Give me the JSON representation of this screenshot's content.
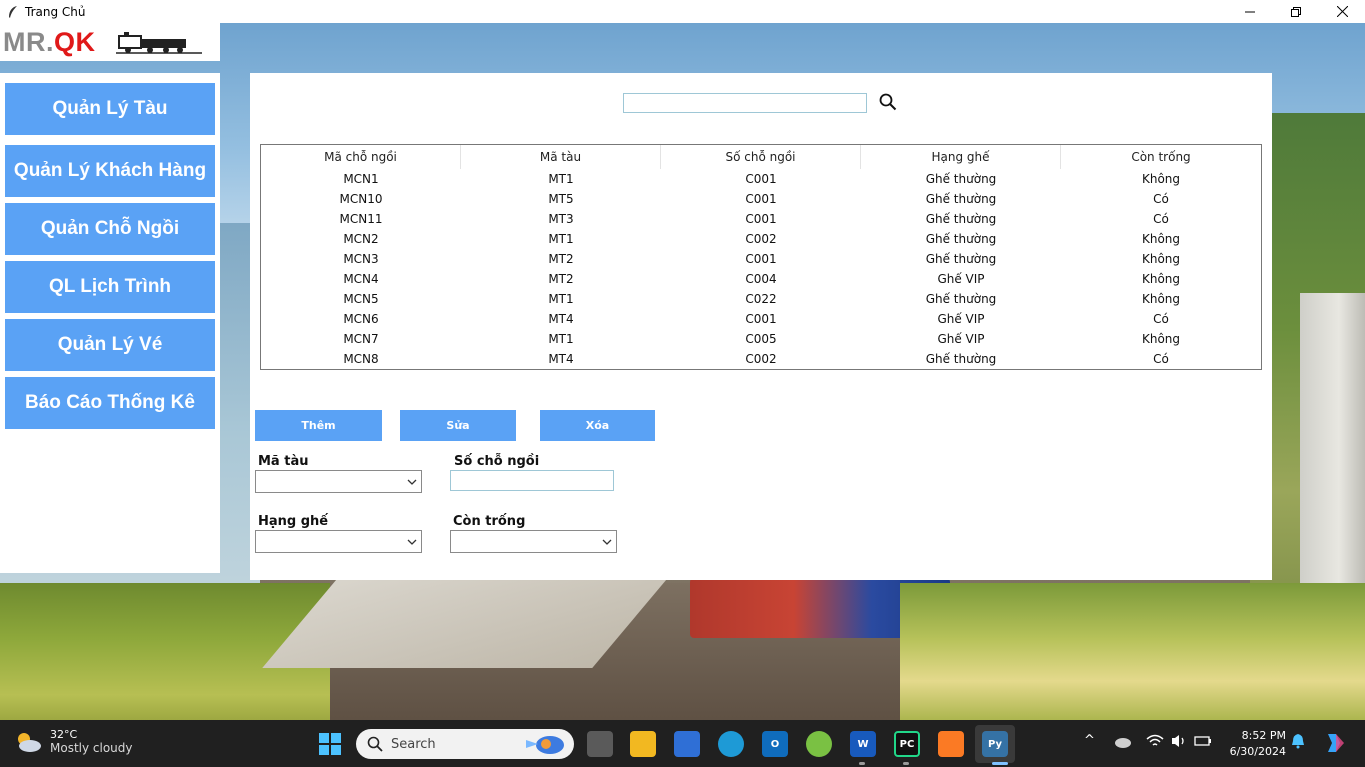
{
  "window": {
    "title": "Trang Chủ",
    "minimize_icon": "minimize-icon",
    "maximize_icon": "maximize-icon",
    "close_icon": "close-icon"
  },
  "logo": {
    "part1": "MR.",
    "part2": "QK",
    "colors": {
      "mr": "#8a8a8a",
      "qk": "#e01919"
    },
    "train_icon": "train-logo-icon"
  },
  "sidebar": {
    "items": [
      {
        "label": "Quản Lý Tàu"
      },
      {
        "label": "Quản Lý Khách Hàng"
      },
      {
        "label": "Quản Chỗ Ngồi"
      },
      {
        "label": "QL Lịch Trình"
      },
      {
        "label": "Quản Lý Vé"
      },
      {
        "label": "Báo Cáo Thống Kê"
      }
    ],
    "accent": "#5aa2f5"
  },
  "search": {
    "value": "",
    "icon": "search-icon"
  },
  "table": {
    "headers": [
      "Mã chỗ ngồi",
      "Mã tàu",
      "Số chỗ ngồi",
      "Hạng ghế",
      "Còn trống"
    ],
    "rows": [
      [
        "MCN1",
        "MT1",
        "C001",
        "Ghế thường",
        "Không"
      ],
      [
        "MCN10",
        "MT5",
        "C001",
        "Ghế thường",
        "Có"
      ],
      [
        "MCN11",
        "MT3",
        "C001",
        "Ghế thường",
        "Có"
      ],
      [
        "MCN2",
        "MT1",
        "C002",
        "Ghế thường",
        "Không"
      ],
      [
        "MCN3",
        "MT2",
        "C001",
        "Ghế thường",
        "Không"
      ],
      [
        "MCN4",
        "MT2",
        "C004",
        "Ghế VIP",
        "Không"
      ],
      [
        "MCN5",
        "MT1",
        "C022",
        "Ghế thường",
        "Không"
      ],
      [
        "MCN6",
        "MT4",
        "C001",
        "Ghế VIP",
        "Có"
      ],
      [
        "MCN7",
        "MT1",
        "C005",
        "Ghế VIP",
        "Không"
      ],
      [
        "MCN8",
        "MT4",
        "C002",
        "Ghế thường",
        "Có"
      ]
    ]
  },
  "actions": {
    "add": "Thêm",
    "edit": "Sửa",
    "delete": "Xóa"
  },
  "form": {
    "train_code_label": "Mã tàu",
    "seat_number_label": "Số chỗ ngồi",
    "seat_class_label": "Hạng ghế",
    "available_label": "Còn trống",
    "train_code_value": "",
    "seat_number_value": "",
    "seat_class_value": "",
    "available_value": ""
  },
  "taskbar": {
    "weather_temp": "32°C",
    "weather_condition": "Mostly cloudy",
    "search_label": "Search",
    "time": "8:52 PM",
    "date": "6/30/2024",
    "apps": [
      "start-icon",
      "task-view-icon",
      "file-explorer-icon",
      "microsoft-store-icon",
      "edge-icon",
      "outlook-icon",
      "app-icon",
      "word-icon",
      "pycharm-icon",
      "xampp-icon",
      "python-icon"
    ]
  }
}
